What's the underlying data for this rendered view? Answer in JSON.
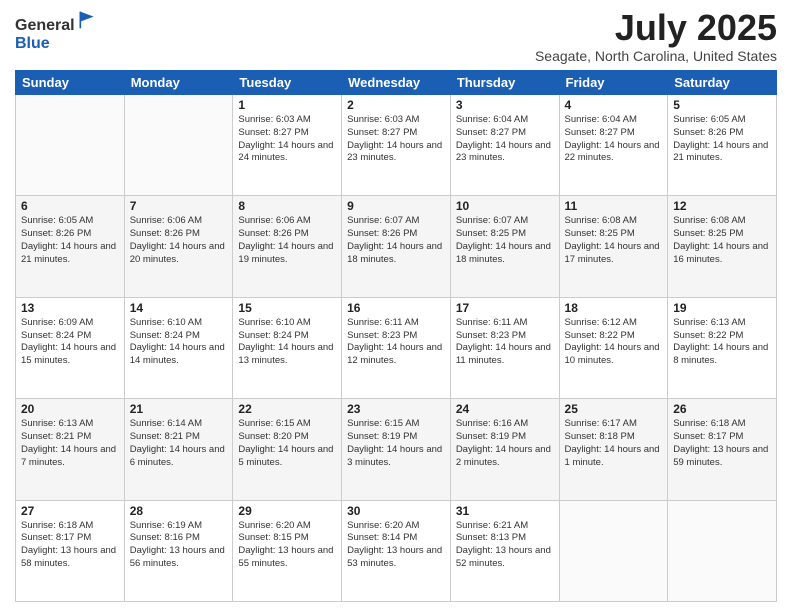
{
  "header": {
    "logo_general": "General",
    "logo_blue": "Blue",
    "month_title": "July 2025",
    "location": "Seagate, North Carolina, United States"
  },
  "weekdays": [
    "Sunday",
    "Monday",
    "Tuesday",
    "Wednesday",
    "Thursday",
    "Friday",
    "Saturday"
  ],
  "weeks": [
    [
      {
        "day": "",
        "info": ""
      },
      {
        "day": "",
        "info": ""
      },
      {
        "day": "1",
        "info": "Sunrise: 6:03 AM\nSunset: 8:27 PM\nDaylight: 14 hours and 24 minutes."
      },
      {
        "day": "2",
        "info": "Sunrise: 6:03 AM\nSunset: 8:27 PM\nDaylight: 14 hours and 23 minutes."
      },
      {
        "day": "3",
        "info": "Sunrise: 6:04 AM\nSunset: 8:27 PM\nDaylight: 14 hours and 23 minutes."
      },
      {
        "day": "4",
        "info": "Sunrise: 6:04 AM\nSunset: 8:27 PM\nDaylight: 14 hours and 22 minutes."
      },
      {
        "day": "5",
        "info": "Sunrise: 6:05 AM\nSunset: 8:26 PM\nDaylight: 14 hours and 21 minutes."
      }
    ],
    [
      {
        "day": "6",
        "info": "Sunrise: 6:05 AM\nSunset: 8:26 PM\nDaylight: 14 hours and 21 minutes."
      },
      {
        "day": "7",
        "info": "Sunrise: 6:06 AM\nSunset: 8:26 PM\nDaylight: 14 hours and 20 minutes."
      },
      {
        "day": "8",
        "info": "Sunrise: 6:06 AM\nSunset: 8:26 PM\nDaylight: 14 hours and 19 minutes."
      },
      {
        "day": "9",
        "info": "Sunrise: 6:07 AM\nSunset: 8:26 PM\nDaylight: 14 hours and 18 minutes."
      },
      {
        "day": "10",
        "info": "Sunrise: 6:07 AM\nSunset: 8:25 PM\nDaylight: 14 hours and 18 minutes."
      },
      {
        "day": "11",
        "info": "Sunrise: 6:08 AM\nSunset: 8:25 PM\nDaylight: 14 hours and 17 minutes."
      },
      {
        "day": "12",
        "info": "Sunrise: 6:08 AM\nSunset: 8:25 PM\nDaylight: 14 hours and 16 minutes."
      }
    ],
    [
      {
        "day": "13",
        "info": "Sunrise: 6:09 AM\nSunset: 8:24 PM\nDaylight: 14 hours and 15 minutes."
      },
      {
        "day": "14",
        "info": "Sunrise: 6:10 AM\nSunset: 8:24 PM\nDaylight: 14 hours and 14 minutes."
      },
      {
        "day": "15",
        "info": "Sunrise: 6:10 AM\nSunset: 8:24 PM\nDaylight: 14 hours and 13 minutes."
      },
      {
        "day": "16",
        "info": "Sunrise: 6:11 AM\nSunset: 8:23 PM\nDaylight: 14 hours and 12 minutes."
      },
      {
        "day": "17",
        "info": "Sunrise: 6:11 AM\nSunset: 8:23 PM\nDaylight: 14 hours and 11 minutes."
      },
      {
        "day": "18",
        "info": "Sunrise: 6:12 AM\nSunset: 8:22 PM\nDaylight: 14 hours and 10 minutes."
      },
      {
        "day": "19",
        "info": "Sunrise: 6:13 AM\nSunset: 8:22 PM\nDaylight: 14 hours and 8 minutes."
      }
    ],
    [
      {
        "day": "20",
        "info": "Sunrise: 6:13 AM\nSunset: 8:21 PM\nDaylight: 14 hours and 7 minutes."
      },
      {
        "day": "21",
        "info": "Sunrise: 6:14 AM\nSunset: 8:21 PM\nDaylight: 14 hours and 6 minutes."
      },
      {
        "day": "22",
        "info": "Sunrise: 6:15 AM\nSunset: 8:20 PM\nDaylight: 14 hours and 5 minutes."
      },
      {
        "day": "23",
        "info": "Sunrise: 6:15 AM\nSunset: 8:19 PM\nDaylight: 14 hours and 3 minutes."
      },
      {
        "day": "24",
        "info": "Sunrise: 6:16 AM\nSunset: 8:19 PM\nDaylight: 14 hours and 2 minutes."
      },
      {
        "day": "25",
        "info": "Sunrise: 6:17 AM\nSunset: 8:18 PM\nDaylight: 14 hours and 1 minute."
      },
      {
        "day": "26",
        "info": "Sunrise: 6:18 AM\nSunset: 8:17 PM\nDaylight: 13 hours and 59 minutes."
      }
    ],
    [
      {
        "day": "27",
        "info": "Sunrise: 6:18 AM\nSunset: 8:17 PM\nDaylight: 13 hours and 58 minutes."
      },
      {
        "day": "28",
        "info": "Sunrise: 6:19 AM\nSunset: 8:16 PM\nDaylight: 13 hours and 56 minutes."
      },
      {
        "day": "29",
        "info": "Sunrise: 6:20 AM\nSunset: 8:15 PM\nDaylight: 13 hours and 55 minutes."
      },
      {
        "day": "30",
        "info": "Sunrise: 6:20 AM\nSunset: 8:14 PM\nDaylight: 13 hours and 53 minutes."
      },
      {
        "day": "31",
        "info": "Sunrise: 6:21 AM\nSunset: 8:13 PM\nDaylight: 13 hours and 52 minutes."
      },
      {
        "day": "",
        "info": ""
      },
      {
        "day": "",
        "info": ""
      }
    ]
  ],
  "row_styles": [
    "row-white",
    "row-shade",
    "row-white",
    "row-shade",
    "row-white"
  ]
}
